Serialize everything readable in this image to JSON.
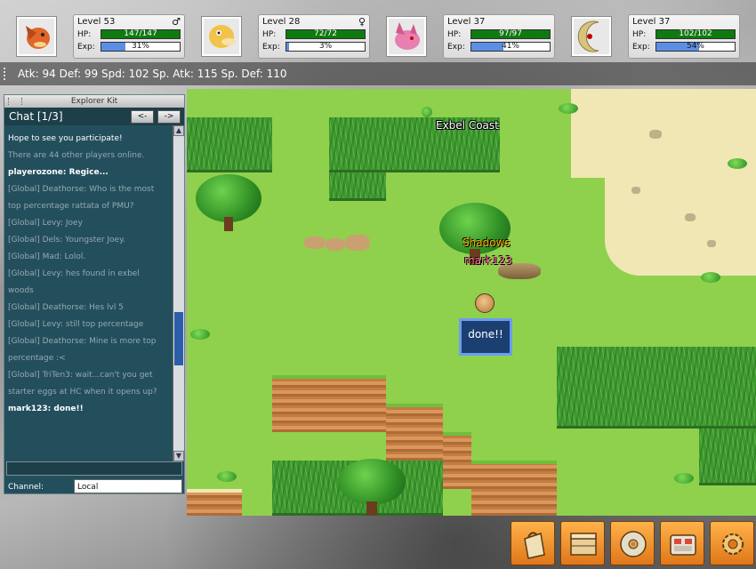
{
  "party": [
    {
      "level_text": "Level 53",
      "gender": "♂",
      "hp_label": "HP:",
      "hp_text": "147/147",
      "exp_label": "Exp:",
      "exp_text": "31%",
      "exp_fraction": 0.31,
      "portrait_color": "#e0662a"
    },
    {
      "level_text": "Level 28",
      "gender": "♀",
      "hp_label": "HP:",
      "hp_text": "72/72",
      "exp_label": "Exp:",
      "exp_text": "3%",
      "exp_fraction": 0.03,
      "portrait_color": "#f2c34a"
    },
    {
      "level_text": "Level 37",
      "gender": "",
      "hp_label": "HP:",
      "hp_text": "97/97",
      "exp_label": "Exp:",
      "exp_text": "41%",
      "exp_fraction": 0.41,
      "portrait_color": "#e77fb0"
    },
    {
      "level_text": "Level 37",
      "gender": "",
      "hp_label": "HP:",
      "hp_text": "102/102",
      "exp_label": "Exp:",
      "exp_text": "54%",
      "exp_fraction": 0.54,
      "portrait_color": "#d9c27a"
    }
  ],
  "stats_line": "Atk: 94 Def: 99 Spd: 102 Sp. Atk: 115 Sp. Def: 110",
  "chat": {
    "window_title": "Explorer Kit",
    "header": "Chat [1/3]",
    "prev_label": "<-",
    "next_label": "->",
    "messages": [
      {
        "text": "Hope to see you participate!",
        "style": "white"
      },
      {
        "text": "There are 44 other players online.",
        "style": "gray"
      },
      {
        "text": "playerozone: Regice...",
        "style": "white-bold"
      },
      {
        "text": "[Global] Deathorse: Who is the most",
        "style": "gray"
      },
      {
        "text": "top percentage rattata of PMU?",
        "style": "gray"
      },
      {
        "text": "[Global] Levy: Joey",
        "style": "gray"
      },
      {
        "text": "[Global] Dels: Youngster Joey.",
        "style": "gray"
      },
      {
        "text": "[Global] Mad: Lolol.",
        "style": "gray"
      },
      {
        "text": "[Global] Levy: hes found in exbel",
        "style": "gray"
      },
      {
        "text": "woods",
        "style": "gray"
      },
      {
        "text": "[Global] Deathorse: Hes lvl 5",
        "style": "gray"
      },
      {
        "text": "[Global] Levy: still top percentage",
        "style": "gray"
      },
      {
        "text": "[Global] Deathorse: Mine is more top",
        "style": "gray"
      },
      {
        "text": "percentage :<",
        "style": "gray"
      },
      {
        "text": "[Global] TriTen3: wait...can't you get",
        "style": "gray"
      },
      {
        "text": "starter eggs at HC when it opens up?",
        "style": "gray"
      },
      {
        "text": "mark123: done!!",
        "style": "white-bold"
      }
    ],
    "channel_label": "Channel:",
    "channel_value": "Local"
  },
  "map": {
    "name": "Exbel Coast",
    "npc_label_1": "Shadows",
    "npc_label_2": "mark123",
    "speech_bubble": "done!!"
  },
  "toolbar": [
    {
      "icon": "bag-icon"
    },
    {
      "icon": "storage-box-icon"
    },
    {
      "icon": "disc-icon"
    },
    {
      "icon": "team-case-icon"
    },
    {
      "icon": "settings-gear-icon"
    }
  ]
}
